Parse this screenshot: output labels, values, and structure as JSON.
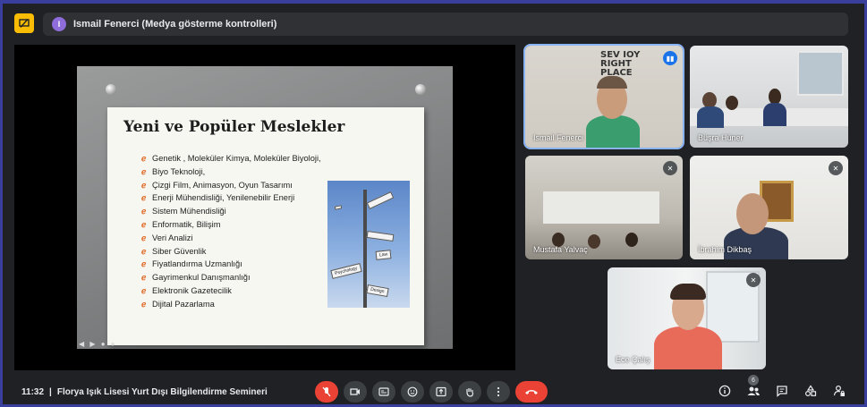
{
  "topbar": {
    "presenter_initial": "I",
    "presenter_text": "Ismail Fenerci (Medya gösterme kontrolleri)"
  },
  "slide": {
    "title": "Yeni ve Popüler Meslekler",
    "items": [
      "Genetik , Moleküler Kimya, Moleküler Biyoloji,",
      "Biyo Teknoloji,",
      "Çizgi Film, Animasyon, Oyun Tasarımı",
      "Enerji Mühendisliği, Yenilenebilir Enerji",
      "Sistem Mühendisliği",
      "Enformatik, Bilişim",
      "Veri Analizi",
      "Siber Güvenlik",
      "Fiyatlandırma Uzmanlığı",
      "Gayrimenkul Danışmanlığı",
      "Elektronik Gazetecilik",
      "Dijital Pazarlama"
    ],
    "image_signs": [
      "Psychology",
      "Law",
      "Design"
    ]
  },
  "participants": [
    {
      "name": "Ismail Fenerci",
      "speaking": true
    },
    {
      "name": "Büşra Hüner",
      "speaking": false
    },
    {
      "name": "Mustafa Yalvaç",
      "speaking": false
    },
    {
      "name": "İbrahim Dikbaş",
      "speaking": false
    },
    {
      "name": "Ece Çalış",
      "speaking": false
    }
  ],
  "meeting": {
    "time": "11:32",
    "separator": "|",
    "title": "Florya Işık Lisesi Yurt Dışı Bilgilendirme Semineri",
    "participant_count": "6"
  },
  "colors": {
    "accent": "#8ab4f8",
    "end_call": "#ea4335",
    "presenter_badge": "#8e6cd9",
    "frame": "#3a3f9e"
  }
}
